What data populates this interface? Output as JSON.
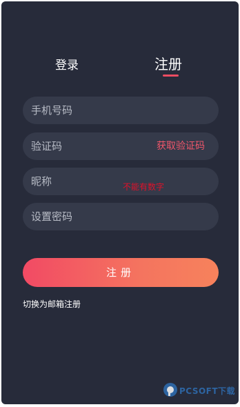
{
  "tabs": {
    "login_label": "登录",
    "register_label": "注册",
    "active": "register"
  },
  "form": {
    "phone_placeholder": "手机号码",
    "code_placeholder": "验证码",
    "get_code_label": "获取验证码",
    "nickname_placeholder": "昵称",
    "nickname_error": "不能有数字",
    "password_placeholder": "设置密码"
  },
  "submit_label": "注册",
  "switch_link_label": "切换为邮箱注册",
  "watermark": {
    "text": "PCSOFT下载",
    "icon": "pcsoft-logo-icon"
  },
  "colors": {
    "background": "#272b3a",
    "field": "#353a4a",
    "accent": "#ee4d62",
    "error": "#e0112a"
  }
}
